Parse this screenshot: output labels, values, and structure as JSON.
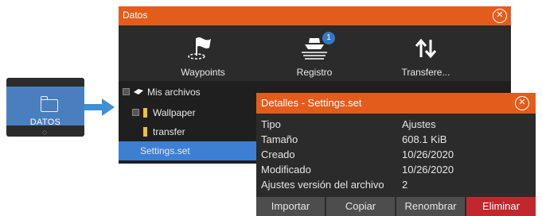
{
  "tile": {
    "label": "DATOS"
  },
  "window": {
    "title": "Datos",
    "toolbar": [
      {
        "label": "Waypoints",
        "icon": "waypoint-flag-icon"
      },
      {
        "label": "Registro",
        "icon": "boat-track-icon",
        "badge": "1"
      },
      {
        "label": "Transfere...",
        "icon": "transfer-arrows-icon"
      }
    ],
    "tree": {
      "root": "Mis archivos",
      "items": [
        "Wallpaper",
        "transfer",
        "Settings.set"
      ]
    }
  },
  "dialog": {
    "title": "Detalles - Settings.set",
    "properties": [
      {
        "name": "Tipo",
        "value": "Ajustes"
      },
      {
        "name": "Tamaño",
        "value": "608.1 KiB"
      },
      {
        "name": "Creado",
        "value": "10/26/2020"
      },
      {
        "name": "Modificado",
        "value": "10/26/2020"
      },
      {
        "name": "Ajustes versión del archivo",
        "value": "2"
      }
    ],
    "buttons": {
      "import": "Importar",
      "copy": "Copiar",
      "rename": "Renombrar",
      "delete": "Eliminar"
    }
  },
  "colors": {
    "accent": "#e45c1b",
    "selection": "#3d7fd1",
    "danger": "#c1272d",
    "tile": "#4a7fbe"
  }
}
